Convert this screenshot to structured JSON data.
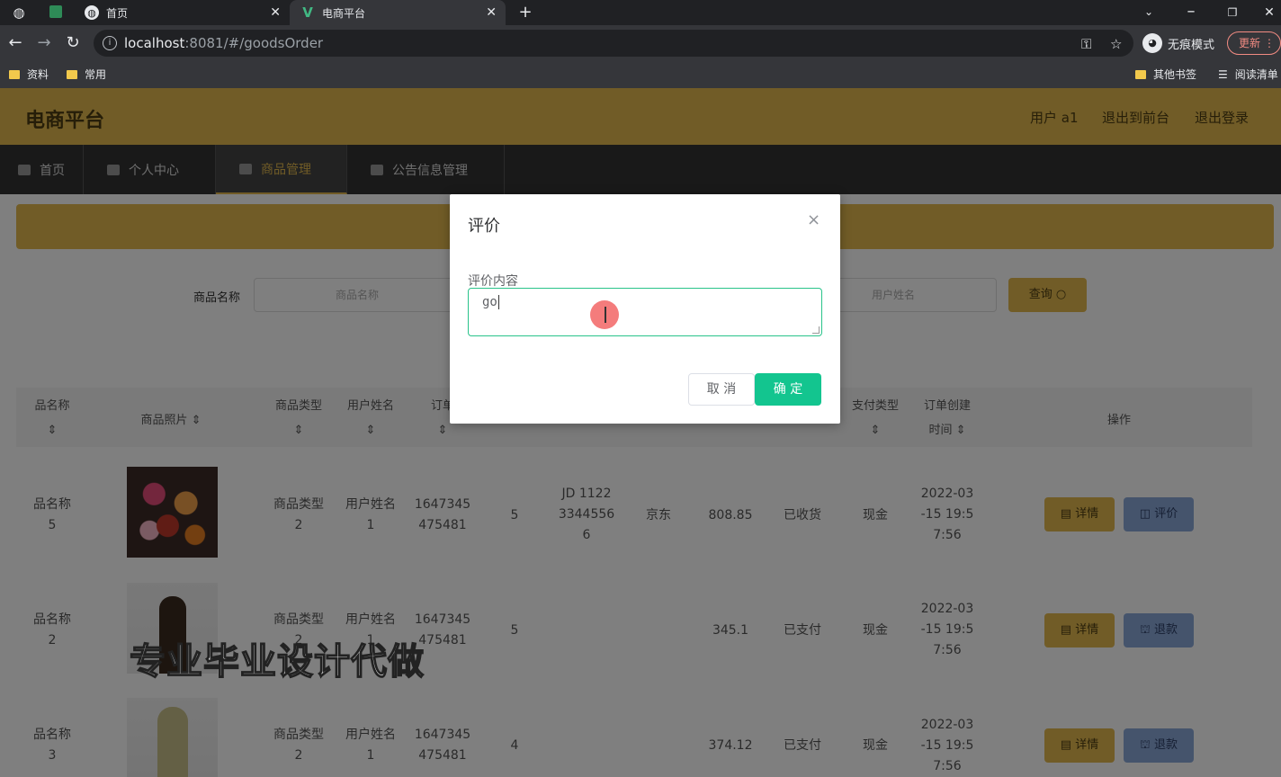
{
  "browser": {
    "tabs": [
      {
        "title": "首页",
        "icon": "globe-icon"
      },
      {
        "title": "电商平台",
        "icon": "vue-icon"
      }
    ],
    "url_host": "localhost",
    "url_rest": ":8081/#/goodsOrder",
    "profile_label": "无痕模式",
    "update_label": "更新",
    "bookmarks": [
      "资料",
      "常用"
    ],
    "other_bookmarks": "其他书签",
    "reading_list": "阅读清单"
  },
  "header": {
    "brand": "电商平台",
    "user": "用户 a1",
    "back_front": "退出到前台",
    "logout": "退出登录"
  },
  "nav": [
    "首页",
    "个人中心",
    "商品管理",
    "公告信息管理"
  ],
  "search": {
    "label_goods": "商品名称",
    "goods_placeholder": "商品名称",
    "user_placeholder": "用户姓名",
    "query_label": "查询"
  },
  "table": {
    "headers": {
      "goods_name": "品名称",
      "goods_photo": "商品照片",
      "goods_type": "商品类型",
      "user_name": "用户姓名",
      "order": "订单",
      "pay_type": "支付类型",
      "order_time_1": "订单创建",
      "order_time_2": "时间",
      "actions": "操作",
      "sort": "⇕"
    },
    "rows": [
      {
        "name_1": "品名称",
        "name_2": "5",
        "type_1": "商品类型",
        "type_2": "2",
        "user_1": "用户姓名",
        "user_2": "1",
        "order_1": "1647345",
        "order_2": "475481",
        "qty": "5",
        "track_1": "JD 1122",
        "track_2": "3344556",
        "track_3": "6",
        "courier": "京东",
        "price": "808.85",
        "status": "已收货",
        "pay": "现金",
        "time_1": "2022-03",
        "time_2": "-15 19:5",
        "time_3": "7:56",
        "btn_detail": "详情",
        "btn_other": "评价"
      },
      {
        "name_1": "品名称",
        "name_2": "2",
        "type_1": "商品类型",
        "type_2": "2",
        "user_1": "用户姓名",
        "user_2": "1",
        "order_1": "1647345",
        "order_2": "475481",
        "qty": "5",
        "price": "345.1",
        "status": "已支付",
        "pay": "现金",
        "time_1": "2022-03",
        "time_2": "-15 19:5",
        "time_3": "7:56",
        "btn_detail": "详情",
        "btn_other": "退款"
      },
      {
        "name_1": "品名称",
        "name_2": "3",
        "type_1": "商品类型",
        "type_2": "2",
        "user_1": "用户姓名",
        "user_2": "1",
        "order_1": "1647345",
        "order_2": "475481",
        "qty": "4",
        "price": "374.12",
        "status": "已支付",
        "pay": "现金",
        "time_1": "2022-03",
        "time_2": "-15 19:5",
        "time_3": "7:56",
        "btn_detail": "详情",
        "btn_other": "退款"
      }
    ]
  },
  "watermark": "专业毕业设计代做",
  "dialog": {
    "title": "评价",
    "field_label": "评价内容",
    "textarea_value": "go",
    "cancel": "取 消",
    "confirm": "确 定"
  },
  "colors": {
    "theme": "#e2b94e",
    "confirm": "#13c58f",
    "nav_bg": "#333333"
  }
}
